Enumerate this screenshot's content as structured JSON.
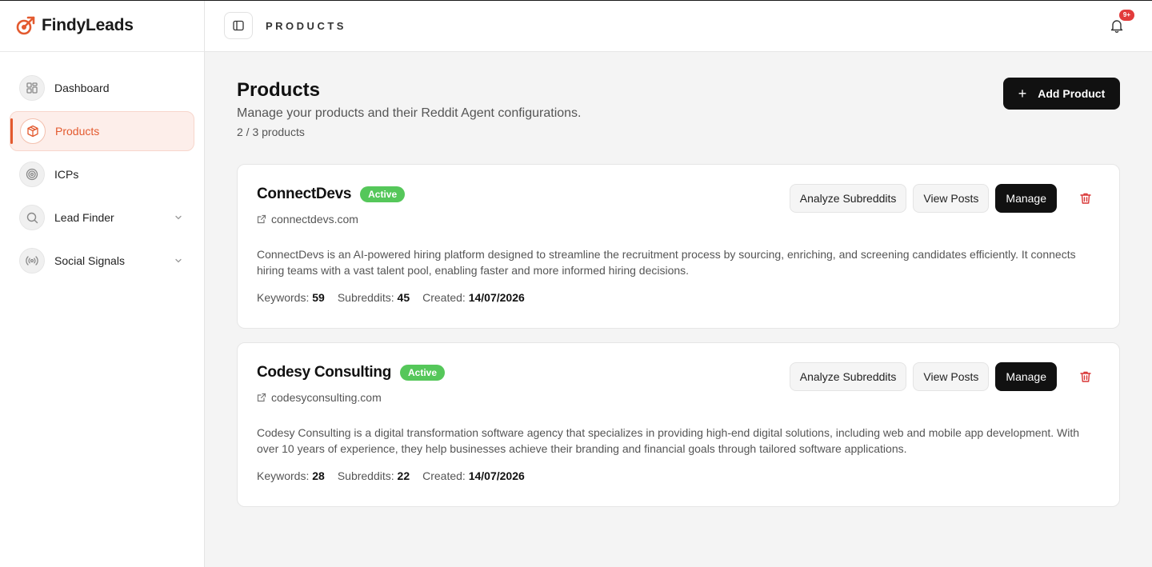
{
  "brand": {
    "name": "FindyLeads"
  },
  "sidebar": {
    "items": [
      {
        "label": "Dashboard",
        "icon": "grid-icon",
        "active": false,
        "expandable": false
      },
      {
        "label": "Products",
        "icon": "box-icon",
        "active": true,
        "expandable": false
      },
      {
        "label": "ICPs",
        "icon": "target-icon",
        "active": false,
        "expandable": false
      },
      {
        "label": "Lead Finder",
        "icon": "search-icon",
        "active": false,
        "expandable": true
      },
      {
        "label": "Social Signals",
        "icon": "broadcast-icon",
        "active": false,
        "expandable": true
      }
    ]
  },
  "header": {
    "title": "PRODUCTS",
    "notification_badge": "9+"
  },
  "page": {
    "title": "Products",
    "subtitle": "Manage your products and their Reddit Agent configurations.",
    "count": "2 / 3 products",
    "add_button_label": "Add Product"
  },
  "labels": {
    "keywords": "Keywords:",
    "subreddits": "Subreddits:",
    "created": "Created:",
    "analyze": "Analyze Subreddits",
    "view_posts": "View Posts",
    "manage": "Manage"
  },
  "products": [
    {
      "name": "ConnectDevs",
      "status": "Active",
      "url": "connectdevs.com",
      "description": "ConnectDevs is an AI-powered hiring platform designed to streamline the recruitment process by sourcing, enriching, and screening candidates efficiently. It connects hiring teams with a vast talent pool, enabling faster and more informed hiring decisions.",
      "keywords": "59",
      "subreddits": "45",
      "created": "14/07/2026"
    },
    {
      "name": "Codesy Consulting",
      "status": "Active",
      "url": "codesyconsulting.com",
      "description": "Codesy Consulting is a digital transformation software agency that specializes in providing high-end digital solutions, including web and mobile app development. With over 10 years of experience, they help businesses achieve their branding and financial goals through tailored software applications.",
      "keywords": "28",
      "subreddits": "22",
      "created": "14/07/2026"
    }
  ],
  "colors": {
    "accent": "#e35a2f",
    "active_badge": "#55c75a",
    "danger": "#d93636",
    "primary_button": "#111111"
  }
}
